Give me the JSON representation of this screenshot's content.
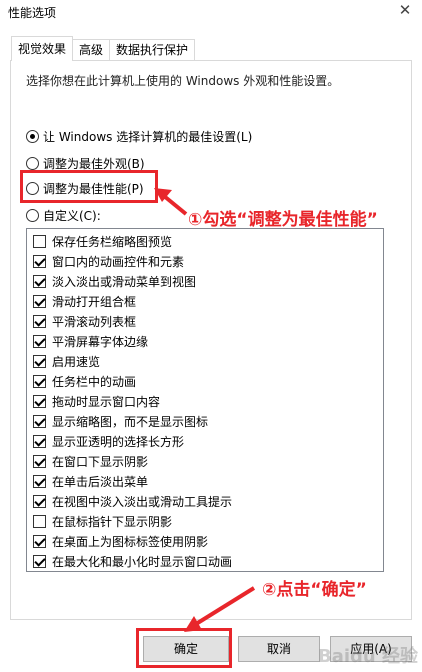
{
  "window": {
    "title": "性能选项",
    "close_symbol": "✕"
  },
  "tabs": [
    {
      "label": "视觉效果",
      "active": true
    },
    {
      "label": "高级",
      "active": false
    },
    {
      "label": "数据执行保护",
      "active": false
    }
  ],
  "intro": "选择你想在此计算机上使用的 Windows 外观和性能设置。",
  "radios": [
    {
      "label": "让 Windows 选择计算机的最佳设置(L)",
      "selected": true
    },
    {
      "label": "调整为最佳外观(B)",
      "selected": false
    },
    {
      "label": "调整为最佳性能(P)",
      "selected": false
    },
    {
      "label": "自定义(C):",
      "selected": false
    }
  ],
  "checkboxes": [
    {
      "label": "保存任务栏缩略图预览",
      "checked": false
    },
    {
      "label": "窗口内的动画控件和元素",
      "checked": true
    },
    {
      "label": "淡入淡出或滑动菜单到视图",
      "checked": true
    },
    {
      "label": "滑动打开组合框",
      "checked": true
    },
    {
      "label": "平滑滚动列表框",
      "checked": true
    },
    {
      "label": "平滑屏幕字体边缘",
      "checked": true
    },
    {
      "label": "启用速览",
      "checked": true
    },
    {
      "label": "任务栏中的动画",
      "checked": true
    },
    {
      "label": "拖动时显示窗口内容",
      "checked": true
    },
    {
      "label": "显示缩略图，而不是显示图标",
      "checked": true
    },
    {
      "label": "显示亚透明的选择长方形",
      "checked": true
    },
    {
      "label": "在窗口下显示阴影",
      "checked": true
    },
    {
      "label": "在单击后淡出菜单",
      "checked": true
    },
    {
      "label": "在视图中淡入淡出或滑动工具提示",
      "checked": true
    },
    {
      "label": "在鼠标指针下显示阴影",
      "checked": false
    },
    {
      "label": "在桌面上为图标标签使用阴影",
      "checked": true
    },
    {
      "label": "在最大化和最小化时显示窗口动画",
      "checked": true
    }
  ],
  "buttons": {
    "ok": "确定",
    "cancel": "取消",
    "apply": "应用(A)"
  },
  "annotations": {
    "step1": "①勾选“调整为最佳性能”",
    "step2": "②点击“确定”"
  },
  "watermark": "Baidu 经验",
  "colors": {
    "annotation_red": "#e8262b",
    "panel_border": "#d9d9d9",
    "button_face": "#e1e1e1"
  }
}
